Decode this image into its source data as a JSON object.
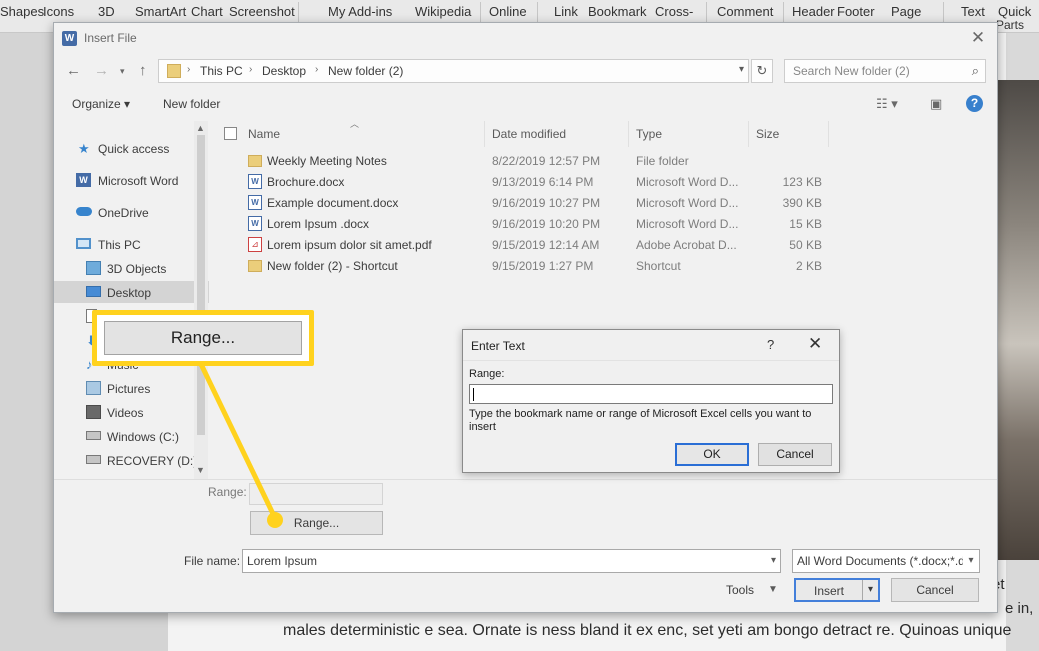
{
  "ribbon": {
    "top_items": [
      "Shapes",
      "Icons",
      "3D",
      "SmartArt",
      "Chart",
      "Screenshot",
      "My Add-ins",
      "Wikipedia",
      "Online",
      "Link",
      "Bookmark",
      "Cross-",
      "Comment",
      "Header",
      "Footer",
      "Page",
      "Text",
      "Quick"
    ],
    "sub_items": [
      "Parts"
    ]
  },
  "document": {
    "line1": "males deterministic e sea. Ornate is ness bland it ex enc, set yeti am bongo detract re. Quinoas unique",
    "fragment_right_1": "et",
    "fragment_right_2": "e in,"
  },
  "dialog": {
    "title": "Insert File",
    "breadcrumb": [
      "This PC",
      "Desktop",
      "New folder (2)"
    ],
    "search_placeholder": "Search New folder (2)",
    "toolbar": {
      "organize": "Organize",
      "new_folder": "New folder"
    },
    "tree": [
      {
        "label": "Quick access",
        "icon": "star-icon"
      },
      {
        "label": "Microsoft Word",
        "icon": "word-icon"
      },
      {
        "label": "OneDrive",
        "icon": "cloud-icon"
      },
      {
        "label": "This PC",
        "icon": "computer-icon"
      },
      {
        "label": "3D Objects",
        "icon": "cube-icon"
      },
      {
        "label": "Desktop",
        "icon": "desktop-icon",
        "selected": true
      },
      {
        "label": "",
        "icon": "documents-icon"
      },
      {
        "label": "",
        "icon": "downloads-icon"
      },
      {
        "label": "Music",
        "icon": "music-icon"
      },
      {
        "label": "Pictures",
        "icon": "pictures-icon"
      },
      {
        "label": "Videos",
        "icon": "videos-icon"
      },
      {
        "label": "Windows (C:)",
        "icon": "drive-icon"
      },
      {
        "label": "RECOVERY (D:)",
        "icon": "drive-icon"
      }
    ],
    "columns": [
      "Name",
      "Date modified",
      "Type",
      "Size"
    ],
    "files": [
      {
        "name": "Weekly Meeting Notes",
        "date": "8/22/2019 12:57 PM",
        "type": "File folder",
        "size": "",
        "icon": "folder-icon"
      },
      {
        "name": "Brochure.docx",
        "date": "9/13/2019 6:14 PM",
        "type": "Microsoft Word D...",
        "size": "123 KB",
        "icon": "word-doc-icon"
      },
      {
        "name": "Example document.docx",
        "date": "9/16/2019 10:27 PM",
        "type": "Microsoft Word D...",
        "size": "390 KB",
        "icon": "word-doc-icon"
      },
      {
        "name": "Lorem Ipsum .docx",
        "date": "9/16/2019 10:20 PM",
        "type": "Microsoft Word D...",
        "size": "15 KB",
        "icon": "word-doc-icon"
      },
      {
        "name": "Lorem ipsum dolor sit amet.pdf",
        "date": "9/15/2019 12:14 AM",
        "type": "Adobe Acrobat D...",
        "size": "50 KB",
        "icon": "pdf-icon"
      },
      {
        "name": "New folder (2) - Shortcut",
        "date": "9/15/2019 1:27 PM",
        "type": "Shortcut",
        "size": "2 KB",
        "icon": "shortcut-icon"
      }
    ],
    "range_label": "Range:",
    "range_button": "Range...",
    "file_name_label": "File name:",
    "file_name_value": "Lorem Ipsum",
    "file_type_value": "All Word Documents (*.docx;*.d",
    "tools_label": "Tools",
    "insert_label": "Insert",
    "cancel_label": "Cancel"
  },
  "enter_text": {
    "title": "Enter Text",
    "help": "?",
    "range_label": "Range:",
    "range_value": "",
    "instructions": "Type the bookmark name or range of Microsoft Excel cells you want to insert",
    "ok_label": "OK",
    "cancel_label": "Cancel"
  },
  "callout": {
    "label": "Range...",
    "accent_color": "#ffd21e"
  }
}
